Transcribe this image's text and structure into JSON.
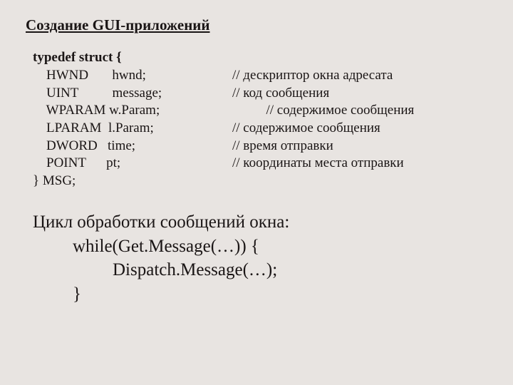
{
  "title": "Создание GUI-приложений",
  "struct": {
    "open": "typedef struct {",
    "rows": [
      {
        "left": "    HWND       hwnd;",
        "right": "// дескриптор окна адресата"
      },
      {
        "left": "    UINT          message;",
        "right": "// код сообщения"
      },
      {
        "left": "    WPARAM w.Param;",
        "right": "          // содержимое сообщения"
      },
      {
        "left": "    LPARAM  l.Param;",
        "right": "// содержимое сообщения"
      },
      {
        "left": "    DWORD   time;",
        "right": "// время отправки"
      },
      {
        "left": "    POINT      pt;",
        "right": "// координаты места отправки"
      }
    ],
    "close": "} MSG;"
  },
  "loop": {
    "l1": "Цикл обработки сообщений окна:",
    "l2": "while(Get.Message(…)) {",
    "l3": "Dispatch.Message(…);",
    "l4": "}"
  }
}
